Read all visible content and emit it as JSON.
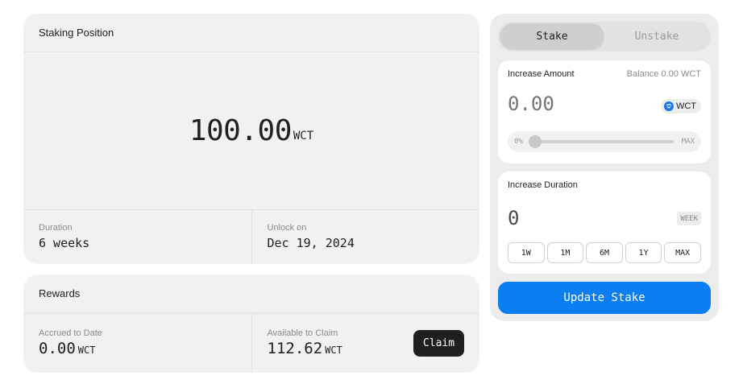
{
  "position": {
    "title": "Staking Position",
    "amount": "100.00",
    "token": "WCT",
    "duration_label": "Duration",
    "duration_value": "6 weeks",
    "unlock_label": "Unlock on",
    "unlock_value": "Dec 19, 2024"
  },
  "rewards": {
    "title": "Rewards",
    "accrued_label": "Accrued to Date",
    "accrued_value": "0.00",
    "available_label": "Available to Claim",
    "available_value": "112.62",
    "token": "WCT",
    "claim_label": "Claim"
  },
  "side_panel": {
    "tabs": [
      {
        "label": "Stake",
        "active": true
      },
      {
        "label": "Unstake",
        "active": false
      }
    ],
    "amount": {
      "title": "Increase Amount",
      "balance": "Balance 0.00 WCT",
      "placeholder": "0.00",
      "token": "WCT",
      "token_icon": "walletconnect-coin-icon",
      "slider_min": "0%",
      "slider_max": "MAX",
      "slider_value": 0
    },
    "duration": {
      "title": "Increase Duration",
      "value": "0",
      "unit": "WEEK",
      "presets": [
        "1W",
        "1M",
        "6M",
        "1Y",
        "MAX"
      ]
    },
    "update_label": "Update Stake"
  },
  "colors": {
    "accent": "#0b7ef2",
    "card_bg": "#f1f1f1",
    "claim_bg": "#1f1f1f"
  }
}
